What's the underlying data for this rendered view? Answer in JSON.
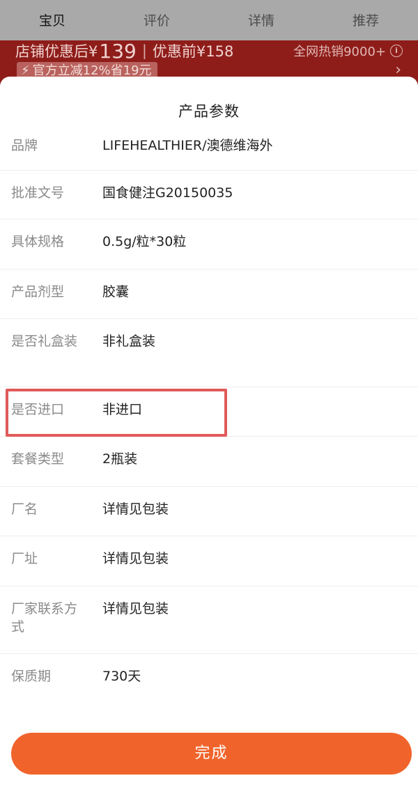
{
  "top_tabs": [
    {
      "label": "宝贝"
    },
    {
      "label": "评价"
    },
    {
      "label": "详情"
    },
    {
      "label": "推荐"
    }
  ],
  "promo": {
    "store_price_label": "店铺优惠后¥",
    "store_price_value": "139",
    "before_price": "优惠前¥158",
    "hot_sales": "全网热销9000+",
    "discount_tag": "官方立减12%省19元"
  },
  "sheet": {
    "title": "产品参数",
    "params": [
      {
        "label": "品牌",
        "value": "LIFEHEALTHIER/澳德维海外"
      },
      {
        "label": "批准文号",
        "value": "国食健注G20150035"
      },
      {
        "label": "具体规格",
        "value": "0.5g/粒*30粒"
      },
      {
        "label": "产品剂型",
        "value": "胶囊"
      },
      {
        "label": "是否礼盒装",
        "value": "非礼盒装"
      },
      {
        "label": "是否进口",
        "value": "非进口"
      },
      {
        "label": "套餐类型",
        "value": "2瓶装"
      },
      {
        "label": "厂名",
        "value": "详情见包装"
      },
      {
        "label": "厂址",
        "value": "详情见包装"
      },
      {
        "label": "厂家联系方式",
        "value": "详情见包装"
      },
      {
        "label": "保质期",
        "value": "730天"
      }
    ],
    "done_label": "完成"
  },
  "colors": {
    "accent": "#f0642b",
    "highlight": "#e15a5a"
  }
}
